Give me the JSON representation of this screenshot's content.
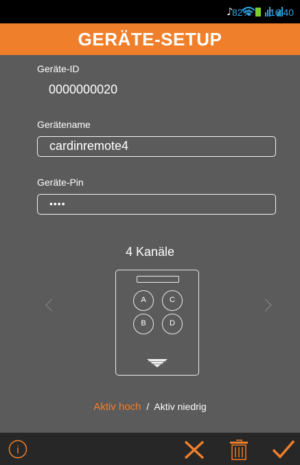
{
  "statusbar": {
    "battery_percent": "82%",
    "time": "16:40",
    "colors": {
      "accent": "#2fa6e6",
      "battery": "#7ccf2a"
    },
    "icons": [
      "mute-icon",
      "wifi-icon",
      "signal-icon",
      "signal-icon",
      "battery-icon"
    ]
  },
  "header": {
    "title": "GERÄTE-SETUP",
    "color": "#f07f2b"
  },
  "device_id": {
    "label": "Geräte-ID",
    "value": "0000000020"
  },
  "device_name": {
    "label": "Gerätename",
    "value": "cardinremote4"
  },
  "device_pin": {
    "label": "Geräte-Pin",
    "value": "••••"
  },
  "channels": {
    "title": "4 Kanäle",
    "buttons": [
      "A",
      "C",
      "B",
      "D"
    ]
  },
  "mode": {
    "active": "Aktiv hoch",
    "separator": "/",
    "inactive": "Aktiv niedrig"
  },
  "bottombar": {
    "icons": [
      "info-icon",
      "close-icon",
      "trash-icon",
      "check-icon"
    ]
  }
}
